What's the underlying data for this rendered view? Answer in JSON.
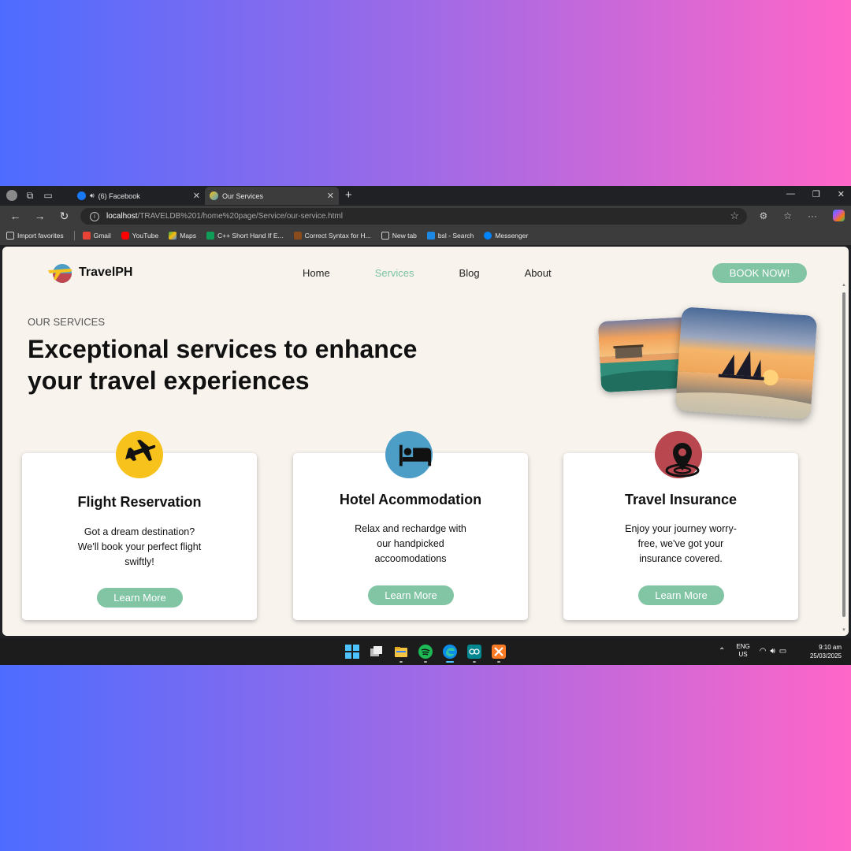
{
  "browser": {
    "tabs": [
      {
        "title": "(6) Facebook",
        "favicon_color": "#1877f2"
      },
      {
        "title": "Our Services",
        "favicon_color": "#e6b84c"
      }
    ],
    "url_host": "localhost",
    "url_path": "/TRAVELDB%201/home%20page/Service/our-service.html",
    "bookmarks": [
      {
        "label": "Import favorites",
        "icon_color": "#cccccc"
      },
      {
        "label": "Gmail",
        "icon_color": "#ea4335"
      },
      {
        "label": "YouTube",
        "icon_color": "#ff0000"
      },
      {
        "label": "Maps",
        "icon_color": "#34a853"
      },
      {
        "label": "C++ Short Hand If E...",
        "icon_color": "#0f9d58"
      },
      {
        "label": "Correct Syntax for H...",
        "icon_color": "#8a4b1c"
      },
      {
        "label": "New tab",
        "icon_color": "#cccccc"
      },
      {
        "label": "bsl - Search",
        "icon_color": "#1e88e5"
      },
      {
        "label": "Messenger",
        "icon_color": "#0084ff"
      }
    ]
  },
  "site": {
    "brand": "TravelPH",
    "nav": {
      "home": "Home",
      "services": "Services",
      "blog": "Blog",
      "about": "About"
    },
    "book_label": "BOOK NOW!",
    "active_nav_color": "#7cc3a1",
    "accent": "#82c5a5"
  },
  "hero": {
    "eyebrow": "OUR SERVICES",
    "headline": "Exceptional services to enhance your travel experiences"
  },
  "services": [
    {
      "title": "Flight Reservation",
      "text": "Got a dream destination? We'll book your perfect flight swiftly!",
      "button": "Learn More",
      "icon": "airplane-icon",
      "icon_color": "#f7c21b"
    },
    {
      "title": "Hotel Acommodation",
      "text": "Relax and rechardge with our handpicked accoomodations",
      "button": "Learn More",
      "icon": "bed-icon",
      "icon_color": "#4d9ec7"
    },
    {
      "title": "Travel Insurance",
      "text": "Enjoy your journey worry-free, we've got your insurance covered.",
      "button": "Learn More",
      "icon": "location-pin-icon",
      "icon_color": "#b9474f"
    }
  ],
  "taskbar": {
    "lang_top": "ENG",
    "lang_bottom": "US",
    "time": "9:10 am",
    "date": "25/03/2025"
  }
}
